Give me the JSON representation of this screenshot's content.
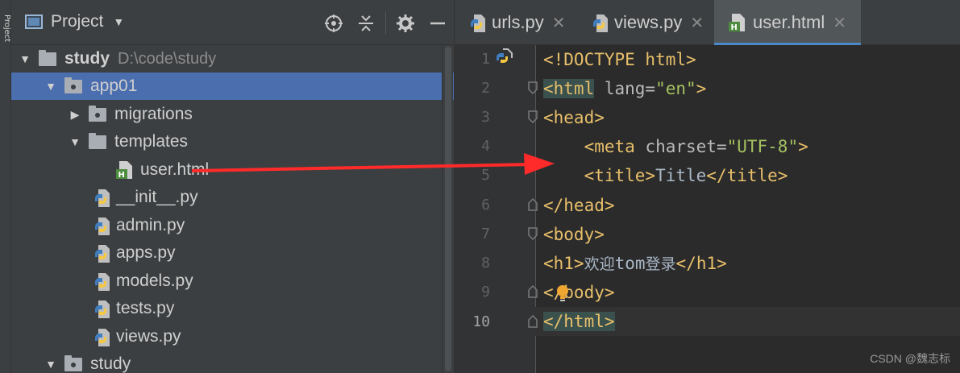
{
  "edge_strip": {
    "text": "Project"
  },
  "project_panel": {
    "title": "Project",
    "tools": [
      "locate-icon",
      "collapse-icon",
      "gear-icon",
      "minimize-icon"
    ],
    "tree": [
      {
        "label": "study",
        "detail": "D:\\code\\study",
        "type": "folder",
        "expanded": true,
        "depth": 0
      },
      {
        "label": "app01",
        "type": "package",
        "expanded": true,
        "depth": 1,
        "selected": true
      },
      {
        "label": "migrations",
        "type": "package",
        "expanded": false,
        "depth": 2
      },
      {
        "label": "templates",
        "type": "folder",
        "expanded": true,
        "depth": 2
      },
      {
        "label": "user.html",
        "type": "html",
        "depth": 3
      },
      {
        "label": "__init__.py",
        "type": "python",
        "depth": 2
      },
      {
        "label": "admin.py",
        "type": "python",
        "depth": 2
      },
      {
        "label": "apps.py",
        "type": "python",
        "depth": 2
      },
      {
        "label": "models.py",
        "type": "python",
        "depth": 2
      },
      {
        "label": "tests.py",
        "type": "python",
        "depth": 2
      },
      {
        "label": "views.py",
        "type": "python",
        "depth": 2
      },
      {
        "label": "study",
        "type": "package",
        "expanded": true,
        "depth": 1
      }
    ]
  },
  "editor": {
    "tabs": [
      {
        "label": "urls.py",
        "icon": "python-file-icon",
        "active": false
      },
      {
        "label": "views.py",
        "icon": "python-file-icon",
        "active": false
      },
      {
        "label": "user.html",
        "icon": "html-file-icon",
        "active": true
      }
    ],
    "line_numbers": [
      "1",
      "2",
      "3",
      "4",
      "5",
      "6",
      "7",
      "8",
      "9",
      "10"
    ],
    "current_line": "10",
    "code": {
      "l1": "<!DOCTYPE html>",
      "l2_tag": "<html",
      "l2_attr": " lang=",
      "l2_val": "\"en\"",
      "l2_end": ">",
      "l3": "<head>",
      "l4_tag": "    <meta",
      "l4_attr": " charset=",
      "l4_val": "\"UTF-8\"",
      "l4_end": ">",
      "l5_open": "    <title>",
      "l5_text": "Title",
      "l5_close": "</title>",
      "l6": "</head>",
      "l7": "<body>",
      "l8_open": "<h1>",
      "l8_cjk1": "欢迎",
      "l8_tom": "tom",
      "l8_cjk2": "登录",
      "l8_close": "</h1>",
      "l9": "</body>",
      "l10": "</html>"
    }
  },
  "watermark": "CSDN @魏志标",
  "colors": {
    "selection": "#4b6eaf",
    "tag": "#e8bf6a",
    "attr_value": "#a5c261",
    "annotation_arrow": "#ff2a2a"
  }
}
